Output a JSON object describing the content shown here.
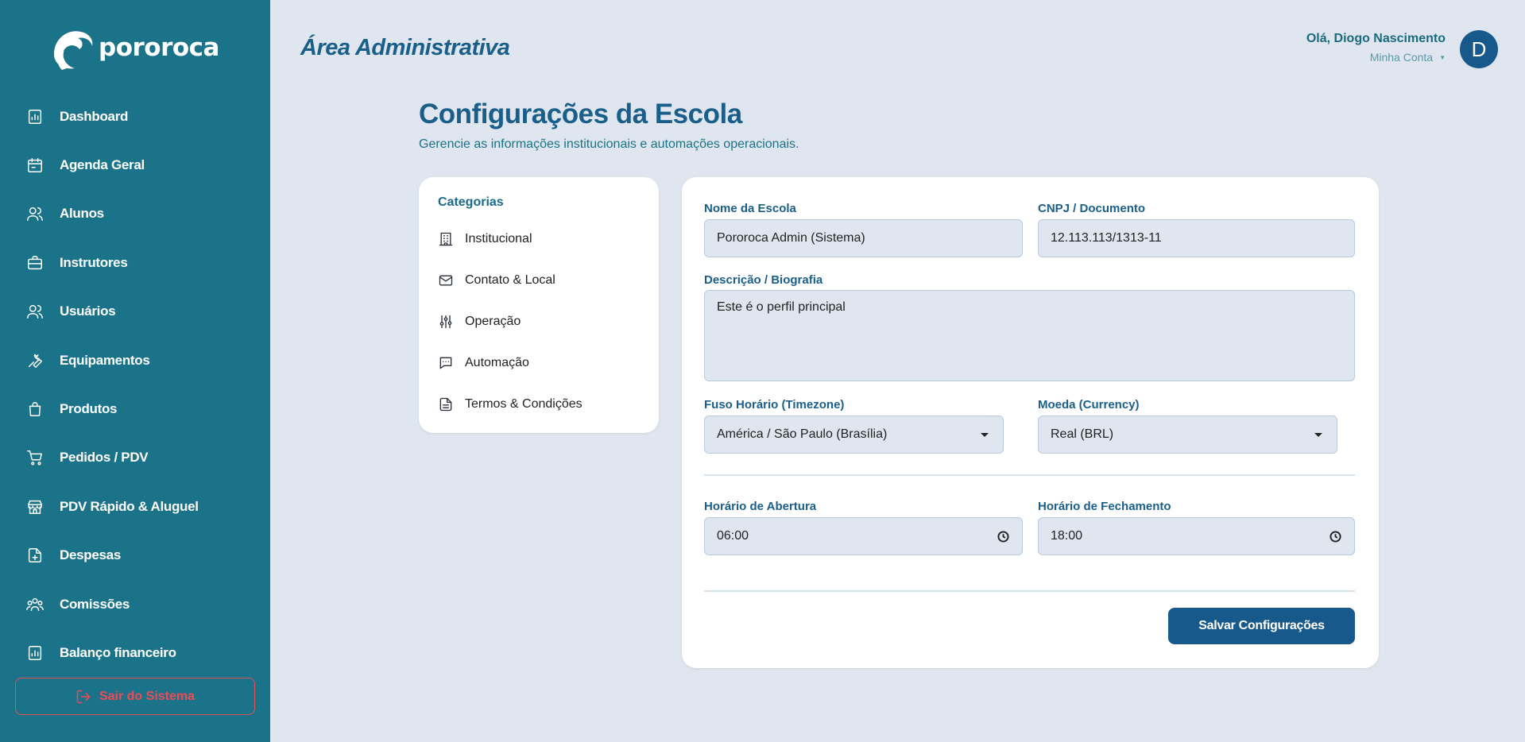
{
  "brand": {
    "name": "pororoca"
  },
  "sidebar": {
    "items": [
      {
        "label": "Dashboard",
        "icon": "chart-icon"
      },
      {
        "label": "Agenda Geral",
        "icon": "calendar-icon"
      },
      {
        "label": "Alunos",
        "icon": "users-icon"
      },
      {
        "label": "Instrutores",
        "icon": "briefcase-icon"
      },
      {
        "label": "Usuários",
        "icon": "users-icon"
      },
      {
        "label": "Equipamentos",
        "icon": "wrench-icon"
      },
      {
        "label": "Produtos",
        "icon": "bag-icon"
      },
      {
        "label": "Pedidos / PDV",
        "icon": "cart-icon"
      },
      {
        "label": "PDV Rápido & Aluguel",
        "icon": "store-icon"
      },
      {
        "label": "Despesas",
        "icon": "file-plus-icon"
      },
      {
        "label": "Comissões",
        "icon": "group-icon"
      },
      {
        "label": "Balanço financeiro",
        "icon": "chart-icon"
      }
    ],
    "logout_label": "Sair do Sistema"
  },
  "header": {
    "title": "Área Administrativa",
    "greeting": "Olá, Diogo Nascimento",
    "account_label": "Minha Conta",
    "avatar_initial": "D"
  },
  "page": {
    "title": "Configurações da Escola",
    "subtitle": "Gerencie as informações institucionais e automações operacionais."
  },
  "categories": {
    "title": "Categorias",
    "items": [
      {
        "label": "Institucional",
        "icon": "building-icon"
      },
      {
        "label": "Contato & Local",
        "icon": "mail-icon"
      },
      {
        "label": "Operação",
        "icon": "sliders-icon"
      },
      {
        "label": "Automação",
        "icon": "chat-icon"
      },
      {
        "label": "Termos & Condições",
        "icon": "document-icon"
      }
    ]
  },
  "form": {
    "school_name": {
      "label": "Nome da Escola",
      "value": "Pororoca Admin (Sistema)"
    },
    "document": {
      "label": "CNPJ / Documento",
      "value": "12.113.113/1313-11"
    },
    "description": {
      "label": "Descrição / Biografia",
      "value": "Este é o perfil principal"
    },
    "timezone": {
      "label": "Fuso Horário (Timezone)",
      "value": "América / São Paulo (Brasília)"
    },
    "currency": {
      "label": "Moeda (Currency)",
      "value": "Real (BRL)"
    },
    "opening": {
      "label": "Horário de Abertura",
      "value": "06:00"
    },
    "closing": {
      "label": "Horário de Fechamento",
      "value": "18:00"
    },
    "save_label": "Salvar Configurações"
  }
}
